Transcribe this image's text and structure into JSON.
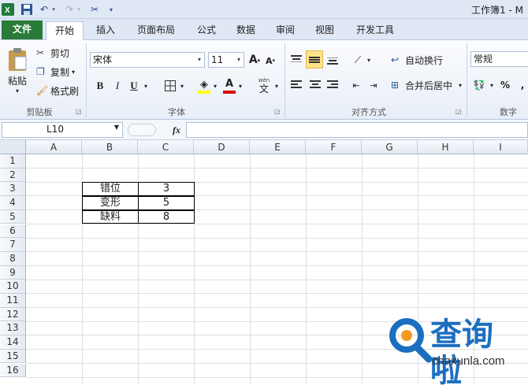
{
  "window": {
    "title": "工作簿1 - M"
  },
  "tabs": [
    {
      "label": "文件"
    },
    {
      "label": "开始"
    },
    {
      "label": "插入"
    },
    {
      "label": "页面布局"
    },
    {
      "label": "公式"
    },
    {
      "label": "数据"
    },
    {
      "label": "审阅"
    },
    {
      "label": "视图"
    },
    {
      "label": "开发工具"
    }
  ],
  "clipboard": {
    "paste": "粘贴",
    "cut": "剪切",
    "copy": "复制",
    "format_painter": "格式刷",
    "group": "剪贴板"
  },
  "font": {
    "name": "宋体",
    "size": "11",
    "bold": "B",
    "italic": "I",
    "underline": "U",
    "group": "字体",
    "grow": "A",
    "shrink": "A",
    "color_letter": "A",
    "phonetic": "wén"
  },
  "alignment": {
    "wrap": "自动换行",
    "merge": "合并后居中",
    "group": "对齐方式"
  },
  "number": {
    "format": "常规",
    "percent": "%",
    "comma": ",",
    "group": "数字"
  },
  "formula_bar": {
    "name_box": "L10",
    "fx": "fx",
    "value": ""
  },
  "sheet": {
    "columns": [
      "A",
      "B",
      "C",
      "D",
      "E",
      "F",
      "G",
      "H",
      "I"
    ],
    "rows": [
      "1",
      "2",
      "3",
      "4",
      "5",
      "6",
      "7",
      "8",
      "9",
      "10",
      "11",
      "12",
      "13",
      "14",
      "15",
      "16"
    ],
    "table": [
      {
        "label": "错位",
        "value": "3"
      },
      {
        "label": "变形",
        "value": "5"
      },
      {
        "label": "缺料",
        "value": "8"
      }
    ]
  },
  "watermark": {
    "title": "查询啦",
    "url": "chaxunla.com"
  },
  "colors": {
    "file_tab": "#2a7a3a",
    "accent": "#2b579a",
    "ribbon_bg": "#e8eef7",
    "watermark_blue": "#1b6fc0",
    "watermark_orange": "#f39a1e"
  }
}
